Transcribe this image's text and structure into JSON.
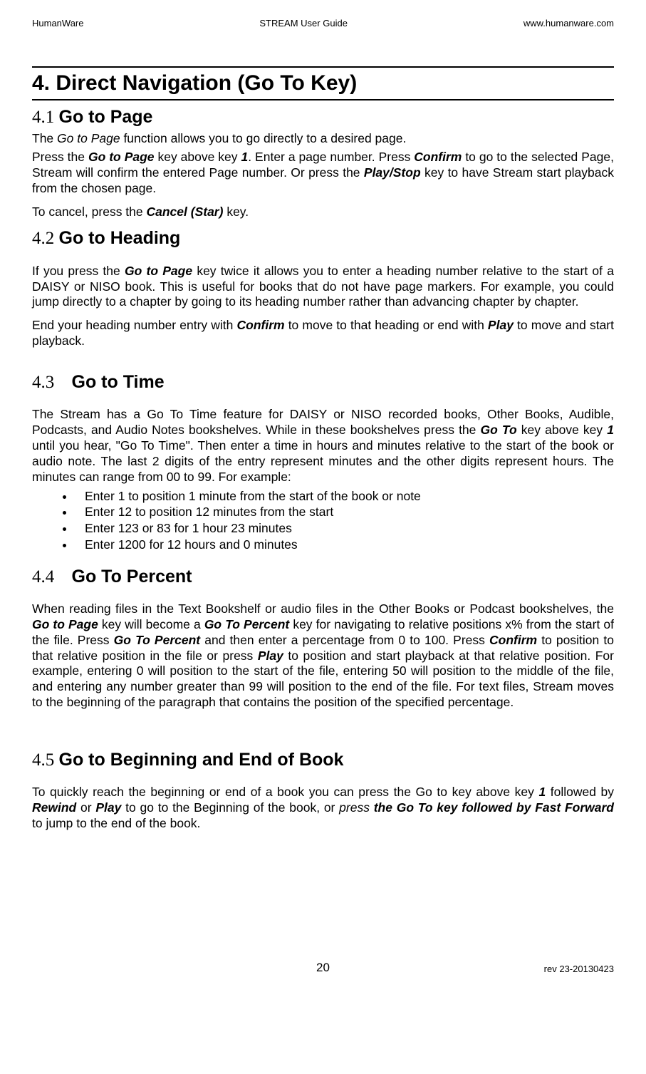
{
  "header": {
    "left": "HumanWare",
    "center": "STREAM User Guide",
    "right": "www.humanware.com"
  },
  "title": "4.  Direct Navigation (Go To Key)",
  "sections": {
    "s41": {
      "num": "4.1",
      "label": "Go to Page",
      "p1": "The Go to Page function allows you to go directly to a desired page.",
      "p2a": "Press the ",
      "p2b": "Go to Page",
      "p2c": " key above key ",
      "p2d": "1",
      "p2e": ". Enter a page number. Press ",
      "p2f": "Confirm",
      "p2g": " to go to the selected Page, Stream will confirm the entered Page number. Or press the ",
      "p2h": "Play/Stop",
      "p2i": " key to have Stream start playback from the chosen page.",
      "p3a": "To cancel, press the ",
      "p3b": "Cancel (Star)",
      "p3c": " key."
    },
    "s42": {
      "num": "4.2",
      "label": "Go to Heading",
      "p1a": "If you press the ",
      "p1b": "Go to Page",
      "p1c": " key twice it allows you to enter a heading number relative to the start of a DAISY or NISO book. This is useful for books that do not have page markers. For example, you could jump directly to a chapter by going to its heading number rather than advancing chapter by chapter.",
      "p2a": "End your heading number entry with ",
      "p2b": "Confirm",
      "p2c": " to move to that heading or end with ",
      "p2d": "Play",
      "p2e": " to move and start playback."
    },
    "s43": {
      "num": "4.3",
      "label": "Go to Time",
      "p1a": "The Stream has a Go To Time feature for DAISY or NISO recorded books, Other Books, Audible, Podcasts, and Audio Notes bookshelves. While in these bookshelves press the ",
      "p1b": "Go To",
      "p1c": " key above key ",
      "p1d": "1",
      "p1e": " until you hear, \"Go To Time\".  Then enter a time in hours and minutes relative to the start of the book or audio note. The last 2 digits of the entry represent minutes and the other digits represent hours. The minutes can range from 00 to 99. For example:",
      "bullets": [
        "Enter 1 to position 1 minute from the start of the book or note",
        "Enter 12 to position 12 minutes from the start",
        "Enter 123 or 83 for 1 hour 23 minutes",
        "Enter 1200 for 12 hours and 0 minutes"
      ]
    },
    "s44": {
      "num": "4.4",
      "label": "Go To Percent",
      "p1a": "When reading files in the Text Bookshelf or audio files in the Other Books or Podcast bookshelves, the ",
      "p1b": "Go to Page",
      "p1c": " key will become a ",
      "p1d": "Go To Percent",
      "p1e": " key for navigating to relative positions x% from the start of the file. Press ",
      "p1f": "Go To Percent",
      "p1g": " and then enter a percentage from 0 to 100. Press ",
      "p1h": "Confirm",
      "p1i": " to position to that relative position in the file or press ",
      "p1j": "Play",
      "p1k": " to position and start playback at that relative position. For example, entering 0 will position to the start of the file, entering 50 will position to the middle of the file, and entering any number greater than 99 will position to the end of the file. For text files, Stream moves to the beginning of the paragraph that contains the position of the specified percentage."
    },
    "s45": {
      "num": "4.5",
      "label": "Go to Beginning and End of Book",
      "p1a": "To quickly reach the beginning or end of a book you can press the Go to key above key ",
      "p1b": "1",
      "p1c": " followed by ",
      "p1d": "Rewind",
      "p1e": " or ",
      "p1f": "Play",
      "p1g": " to go to the Beginning of the book, or ",
      "p1h": "press ",
      "p1i": "the Go To key followed by Fast Forward",
      "p1j": " to jump to the end of the book."
    }
  },
  "footer": {
    "left": "",
    "center": "20",
    "right": "rev     23-20130423"
  }
}
